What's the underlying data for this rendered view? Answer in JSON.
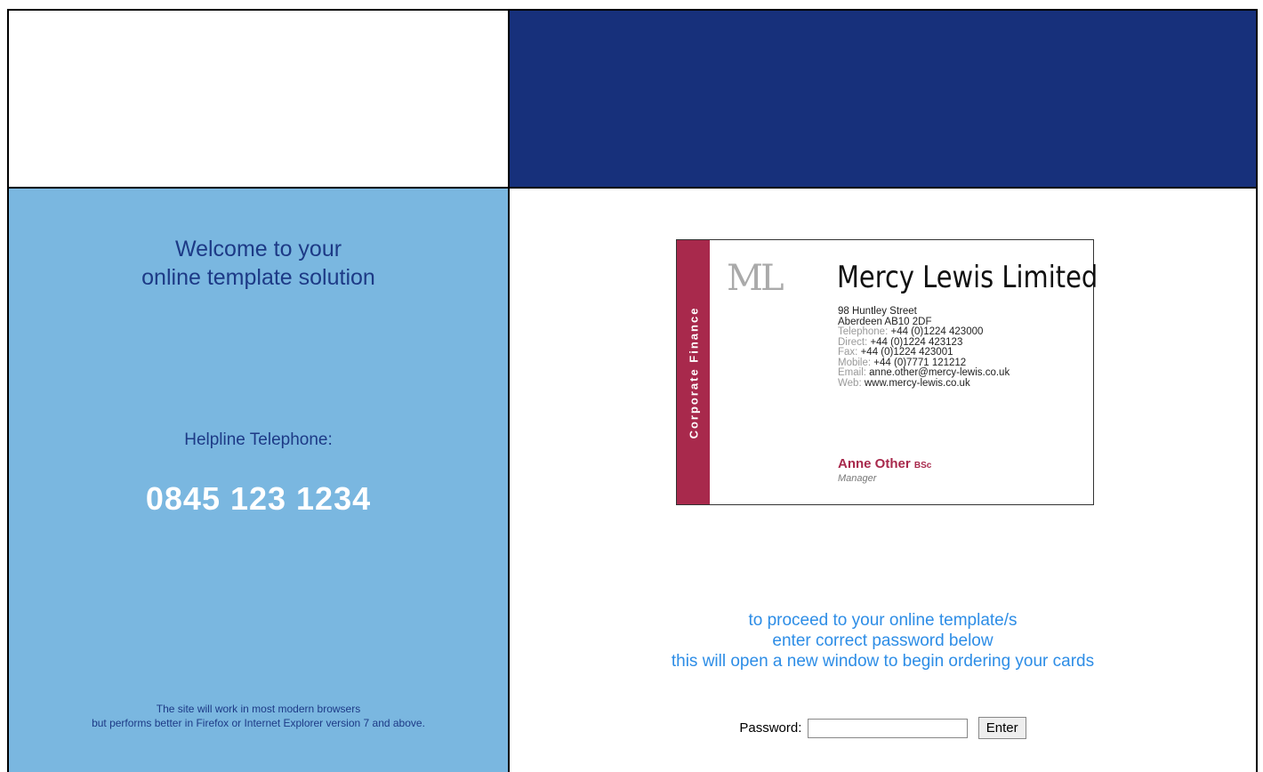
{
  "left_panel": {
    "welcome_line1": "Welcome to your",
    "welcome_line2": "online template solution",
    "helpline_label": "Helpline Telephone:",
    "helpline_number": "0845 123 1234",
    "browser_note_line1": "The site will work in most modern browsers",
    "browser_note_line2": "but performs better in Firefox or Internet Explorer version 7 and above."
  },
  "card": {
    "band_text": "Corporate Finance",
    "monogram": "ML",
    "company_name": "Mercy Lewis Limited",
    "address_line1": "98 Huntley Street",
    "address_line2": "Aberdeen AB10 2DF",
    "telephone_label": "Telephone:",
    "telephone_value": "+44 (0)1224 423000",
    "direct_label": "Direct:",
    "direct_value": "+44 (0)1224 423123",
    "fax_label": "Fax:",
    "fax_value": "+44 (0)1224 423001",
    "mobile_label": "Mobile:",
    "mobile_value": "+44 (0)7771 121212",
    "email_label": "Email:",
    "email_value": "anne.other@mercy-lewis.co.uk",
    "web_label": "Web:",
    "web_value": "www.mercy-lewis.co.uk",
    "person_name": "Anne Other",
    "person_quals": "BSc",
    "person_role": "Manager"
  },
  "main": {
    "instruction_line1": "to proceed to your online template/s",
    "instruction_line2": "enter correct password below",
    "instruction_line3": "this will open a new window to begin ordering your cards",
    "password_label": "Password:",
    "password_value": "",
    "enter_label": "Enter"
  },
  "colors": {
    "header_blue": "#17307b",
    "sidebar_blue": "#7ab7e0",
    "card_band": "#a8294c",
    "instruction_text": "#2d8de6"
  }
}
